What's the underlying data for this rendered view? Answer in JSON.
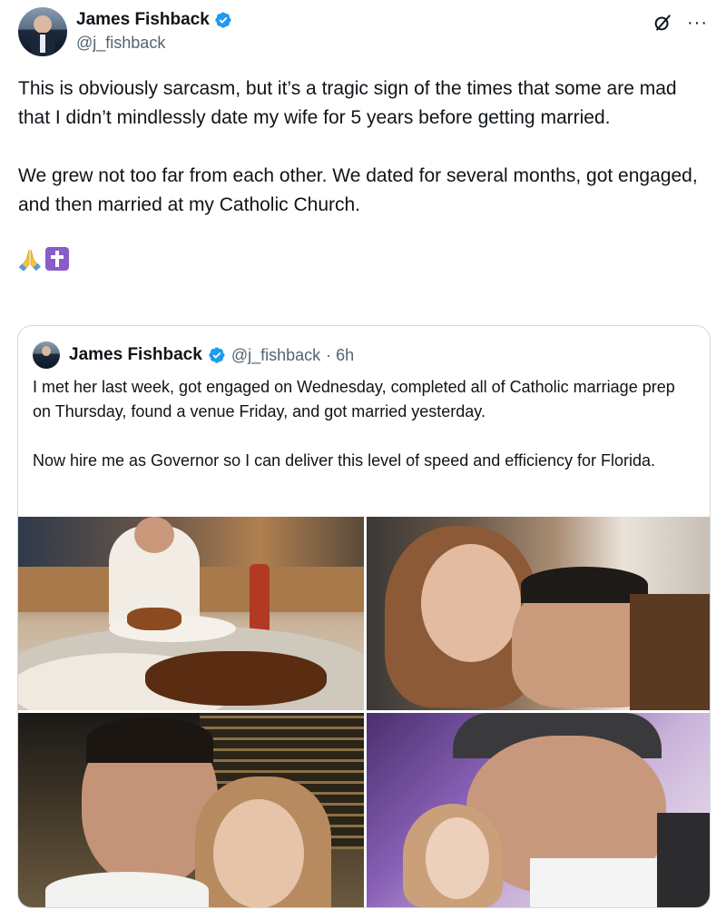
{
  "author": {
    "display_name": "James Fishback",
    "handle": "@j_fishback",
    "verified": true,
    "avatar_icon": "profile-photo"
  },
  "header_icons": [
    "grok-icon",
    "more-icon"
  ],
  "post": {
    "paragraphs": [
      "This is obviously sarcasm, but it’s a tragic sign of the times that some are mad that I didn’t mindlessly date my wife for 5 years before getting married.",
      "We grew not too far from each other. We dated for several months, got engaged, and then married at my Catholic Church."
    ],
    "emojis": [
      "pray-icon",
      "cross-icon"
    ]
  },
  "quote": {
    "display_name": "James Fishback",
    "handle": "@j_fishback",
    "time": "· 6h",
    "paragraphs": [
      "I met her last week, got engaged on Wednesday, completed all of Catholic marriage prep on Thursday, found a venue Friday, and got married yesterday.",
      "Now hire me as Governor so I can deliver this level of speed and efficiency for Florida."
    ],
    "photos": [
      {
        "name": "restaurant-meal-photo"
      },
      {
        "name": "couple-selfie-photo"
      },
      {
        "name": "night-selfie-photo"
      },
      {
        "name": "airplane-selfie-photo"
      }
    ]
  },
  "colors": {
    "text": "#0f1419",
    "secondary": "#536471",
    "verified": "#1d9bf0",
    "border": "#cfd9de"
  }
}
